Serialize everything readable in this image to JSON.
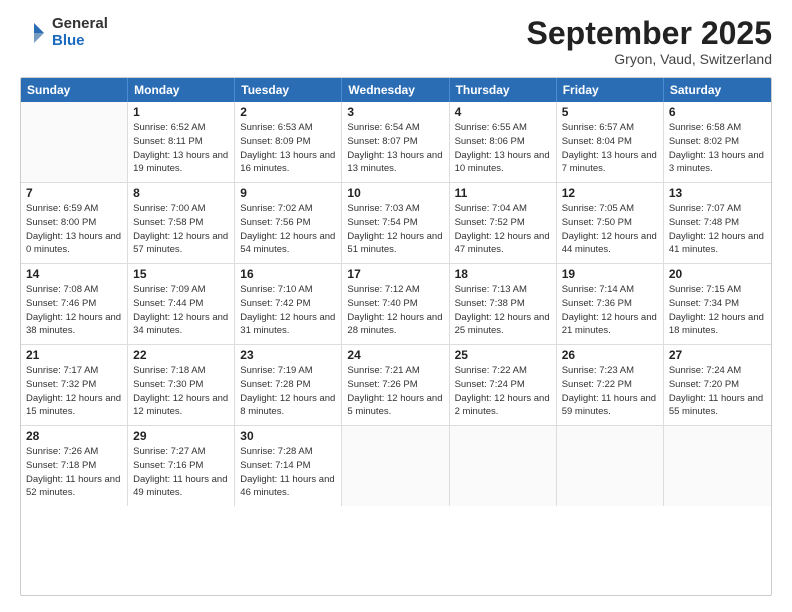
{
  "logo": {
    "general": "General",
    "blue": "Blue"
  },
  "title": "September 2025",
  "location": "Gryon, Vaud, Switzerland",
  "days_of_week": [
    "Sunday",
    "Monday",
    "Tuesday",
    "Wednesday",
    "Thursday",
    "Friday",
    "Saturday"
  ],
  "weeks": [
    [
      {
        "day": null
      },
      {
        "day": "1",
        "info": "Sunrise: 6:52 AM\nSunset: 8:11 PM\nDaylight: 13 hours\nand 19 minutes."
      },
      {
        "day": "2",
        "info": "Sunrise: 6:53 AM\nSunset: 8:09 PM\nDaylight: 13 hours\nand 16 minutes."
      },
      {
        "day": "3",
        "info": "Sunrise: 6:54 AM\nSunset: 8:07 PM\nDaylight: 13 hours\nand 13 minutes."
      },
      {
        "day": "4",
        "info": "Sunrise: 6:55 AM\nSunset: 8:06 PM\nDaylight: 13 hours\nand 10 minutes."
      },
      {
        "day": "5",
        "info": "Sunrise: 6:57 AM\nSunset: 8:04 PM\nDaylight: 13 hours\nand 7 minutes."
      },
      {
        "day": "6",
        "info": "Sunrise: 6:58 AM\nSunset: 8:02 PM\nDaylight: 13 hours\nand 3 minutes."
      }
    ],
    [
      {
        "day": "7",
        "info": "Sunrise: 6:59 AM\nSunset: 8:00 PM\nDaylight: 13 hours\nand 0 minutes."
      },
      {
        "day": "8",
        "info": "Sunrise: 7:00 AM\nSunset: 7:58 PM\nDaylight: 12 hours\nand 57 minutes."
      },
      {
        "day": "9",
        "info": "Sunrise: 7:02 AM\nSunset: 7:56 PM\nDaylight: 12 hours\nand 54 minutes."
      },
      {
        "day": "10",
        "info": "Sunrise: 7:03 AM\nSunset: 7:54 PM\nDaylight: 12 hours\nand 51 minutes."
      },
      {
        "day": "11",
        "info": "Sunrise: 7:04 AM\nSunset: 7:52 PM\nDaylight: 12 hours\nand 47 minutes."
      },
      {
        "day": "12",
        "info": "Sunrise: 7:05 AM\nSunset: 7:50 PM\nDaylight: 12 hours\nand 44 minutes."
      },
      {
        "day": "13",
        "info": "Sunrise: 7:07 AM\nSunset: 7:48 PM\nDaylight: 12 hours\nand 41 minutes."
      }
    ],
    [
      {
        "day": "14",
        "info": "Sunrise: 7:08 AM\nSunset: 7:46 PM\nDaylight: 12 hours\nand 38 minutes."
      },
      {
        "day": "15",
        "info": "Sunrise: 7:09 AM\nSunset: 7:44 PM\nDaylight: 12 hours\nand 34 minutes."
      },
      {
        "day": "16",
        "info": "Sunrise: 7:10 AM\nSunset: 7:42 PM\nDaylight: 12 hours\nand 31 minutes."
      },
      {
        "day": "17",
        "info": "Sunrise: 7:12 AM\nSunset: 7:40 PM\nDaylight: 12 hours\nand 28 minutes."
      },
      {
        "day": "18",
        "info": "Sunrise: 7:13 AM\nSunset: 7:38 PM\nDaylight: 12 hours\nand 25 minutes."
      },
      {
        "day": "19",
        "info": "Sunrise: 7:14 AM\nSunset: 7:36 PM\nDaylight: 12 hours\nand 21 minutes."
      },
      {
        "day": "20",
        "info": "Sunrise: 7:15 AM\nSunset: 7:34 PM\nDaylight: 12 hours\nand 18 minutes."
      }
    ],
    [
      {
        "day": "21",
        "info": "Sunrise: 7:17 AM\nSunset: 7:32 PM\nDaylight: 12 hours\nand 15 minutes."
      },
      {
        "day": "22",
        "info": "Sunrise: 7:18 AM\nSunset: 7:30 PM\nDaylight: 12 hours\nand 12 minutes."
      },
      {
        "day": "23",
        "info": "Sunrise: 7:19 AM\nSunset: 7:28 PM\nDaylight: 12 hours\nand 8 minutes."
      },
      {
        "day": "24",
        "info": "Sunrise: 7:21 AM\nSunset: 7:26 PM\nDaylight: 12 hours\nand 5 minutes."
      },
      {
        "day": "25",
        "info": "Sunrise: 7:22 AM\nSunset: 7:24 PM\nDaylight: 12 hours\nand 2 minutes."
      },
      {
        "day": "26",
        "info": "Sunrise: 7:23 AM\nSunset: 7:22 PM\nDaylight: 11 hours\nand 59 minutes."
      },
      {
        "day": "27",
        "info": "Sunrise: 7:24 AM\nSunset: 7:20 PM\nDaylight: 11 hours\nand 55 minutes."
      }
    ],
    [
      {
        "day": "28",
        "info": "Sunrise: 7:26 AM\nSunset: 7:18 PM\nDaylight: 11 hours\nand 52 minutes."
      },
      {
        "day": "29",
        "info": "Sunrise: 7:27 AM\nSunset: 7:16 PM\nDaylight: 11 hours\nand 49 minutes."
      },
      {
        "day": "30",
        "info": "Sunrise: 7:28 AM\nSunset: 7:14 PM\nDaylight: 11 hours\nand 46 minutes."
      },
      {
        "day": null
      },
      {
        "day": null
      },
      {
        "day": null
      },
      {
        "day": null
      }
    ]
  ]
}
